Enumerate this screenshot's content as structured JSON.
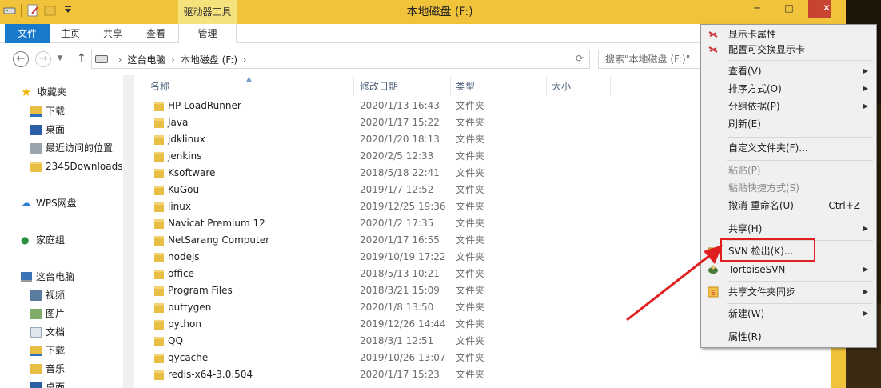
{
  "window": {
    "title": "本地磁盘 (F:)",
    "context_tab_label": "驱动器工具",
    "min_label": "─",
    "max_label": "□",
    "close_label": "✕"
  },
  "ribbon": {
    "tabs": [
      "文件",
      "主页",
      "共享",
      "查看",
      "管理"
    ]
  },
  "address": {
    "crumbs": [
      "这台电脑",
      "本地磁盘 (F:)"
    ],
    "search_placeholder": "搜索\"本地磁盘 (F:)\""
  },
  "nav": {
    "favorites_label": "收藏夹",
    "favorites": [
      "下载",
      "桌面",
      "最近访问的位置",
      "2345Downloads"
    ],
    "wps_label": "WPS网盘",
    "homegroup_label": "家庭组",
    "pc_label": "这台电脑",
    "pc_items": [
      "视频",
      "图片",
      "文档",
      "下载",
      "音乐",
      "桌面"
    ]
  },
  "columns": {
    "name": "名称",
    "date": "修改日期",
    "type": "类型",
    "size": "大小"
  },
  "files": [
    {
      "name": "HP LoadRunner",
      "date": "2020/1/13 16:43",
      "type": "文件夹"
    },
    {
      "name": "Java",
      "date": "2020/1/17 15:22",
      "type": "文件夹"
    },
    {
      "name": "jdklinux",
      "date": "2020/1/20 18:13",
      "type": "文件夹"
    },
    {
      "name": "jenkins",
      "date": "2020/2/5 12:33",
      "type": "文件夹"
    },
    {
      "name": "Ksoftware",
      "date": "2018/5/18 22:41",
      "type": "文件夹"
    },
    {
      "name": "KuGou",
      "date": "2019/1/7 12:52",
      "type": "文件夹"
    },
    {
      "name": "linux",
      "date": "2019/12/25 19:36",
      "type": "文件夹"
    },
    {
      "name": "Navicat Premium 12",
      "date": "2020/1/2 17:35",
      "type": "文件夹"
    },
    {
      "name": "NetSarang Computer",
      "date": "2020/1/17 16:55",
      "type": "文件夹"
    },
    {
      "name": "nodejs",
      "date": "2019/10/19 17:22",
      "type": "文件夹"
    },
    {
      "name": "office",
      "date": "2018/5/13 10:21",
      "type": "文件夹"
    },
    {
      "name": "Program Files",
      "date": "2018/3/21 15:09",
      "type": "文件夹"
    },
    {
      "name": "puttygen",
      "date": "2020/1/8 13:50",
      "type": "文件夹"
    },
    {
      "name": "python",
      "date": "2019/12/26 14:44",
      "type": "文件夹"
    },
    {
      "name": "QQ",
      "date": "2018/3/1 12:51",
      "type": "文件夹"
    },
    {
      "name": "qycache",
      "date": "2019/10/26 13:07",
      "type": "文件夹"
    },
    {
      "name": "redis-x64-3.0.504",
      "date": "2020/1/17 15:23",
      "type": "文件夹"
    }
  ],
  "menu": {
    "display_props": "显示卡属性",
    "switchable_gpu": "配置可交换显示卡",
    "view": "查看(V)",
    "sort": "排序方式(O)",
    "group": "分组依据(P)",
    "refresh": "刷新(E)",
    "customize": "自定义文件夹(F)...",
    "paste": "粘贴(P)",
    "paste_shortcut": "粘贴快捷方式(S)",
    "undo": "撤消 重命名(U)",
    "undo_shortcut": "Ctrl+Z",
    "share": "共享(H)",
    "svn_checkout": "SVN 检出(K)...",
    "tortoise": "TortoiseSVN",
    "share_sync": "共享文件夹同步",
    "new": "新建(W)",
    "properties": "属性(R)"
  },
  "colors": {
    "accent": "#1979ca",
    "titlebar": "#f0c33a",
    "highlight": "#e02020"
  }
}
